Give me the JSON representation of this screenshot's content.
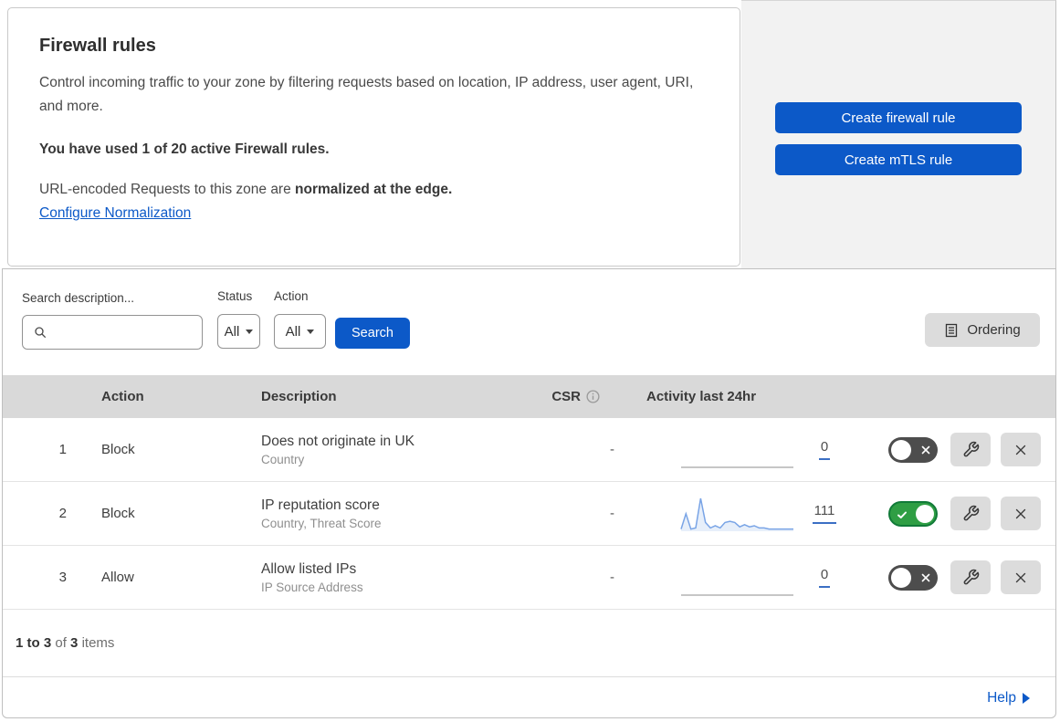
{
  "header": {
    "title": "Firewall rules",
    "description": "Control incoming traffic to your zone by filtering requests based on location, IP address, user agent, URI, and more.",
    "usage_note": "You have used 1 of 20 active Firewall rules.",
    "normalization_prefix": "URL-encoded Requests to this zone are ",
    "normalization_bold": "normalized at the edge.",
    "normalization_link_label": "Configure Normalization"
  },
  "actions_panel": {
    "create_firewall_rule_label": "Create firewall rule",
    "create_mtls_rule_label": "Create mTLS rule"
  },
  "filters": {
    "search_label": "Search description...",
    "status_label": "Status",
    "status_value": "All",
    "action_label": "Action",
    "action_value": "All",
    "search_button_label": "Search",
    "ordering_button_label": "Ordering"
  },
  "table": {
    "headers": {
      "action": "Action",
      "description": "Description",
      "csr": "CSR",
      "activity": "Activity last 24hr"
    },
    "rows": [
      {
        "number": "1",
        "action": "Block",
        "description": "Does not originate in UK",
        "criteria": "Country",
        "csr": "-",
        "activity_count": "0",
        "enabled": false,
        "sparkline": [
          0,
          0,
          0,
          0,
          0,
          0,
          0,
          0,
          0,
          0,
          0,
          0,
          0,
          0,
          0,
          0,
          0,
          0,
          0,
          0,
          0,
          0,
          0,
          0
        ]
      },
      {
        "number": "2",
        "action": "Block",
        "description": "IP reputation score",
        "criteria": "Country, Threat Score",
        "csr": "-",
        "activity_count": "111",
        "enabled": true,
        "sparkline": [
          2,
          16,
          2,
          3,
          30,
          8,
          3,
          5,
          3,
          8,
          9,
          8,
          4,
          6,
          4,
          5,
          3,
          3,
          2,
          2,
          2,
          2,
          2,
          2
        ]
      },
      {
        "number": "3",
        "action": "Allow",
        "description": "Allow listed IPs",
        "criteria": "IP Source Address",
        "csr": "-",
        "activity_count": "0",
        "enabled": false,
        "sparkline": [
          0,
          0,
          0,
          0,
          0,
          0,
          0,
          0,
          0,
          0,
          0,
          0,
          0,
          0,
          0,
          0,
          0,
          0,
          0,
          0,
          0,
          0,
          0,
          0
        ]
      }
    ]
  },
  "pagination": {
    "range": "1 to 3",
    "of_word": "of",
    "total": "3",
    "items_word": "items"
  },
  "help": {
    "label": "Help"
  },
  "colors": {
    "accent_blue": "#0c59c8",
    "toggle_on_green": "#2f9e44",
    "toggle_off_gray": "#4d4d4d",
    "sparkline_blue": "#79a4e6",
    "sparkline_flat_gray": "#b4b4b4",
    "table_header_bg": "#d9d9d9"
  }
}
